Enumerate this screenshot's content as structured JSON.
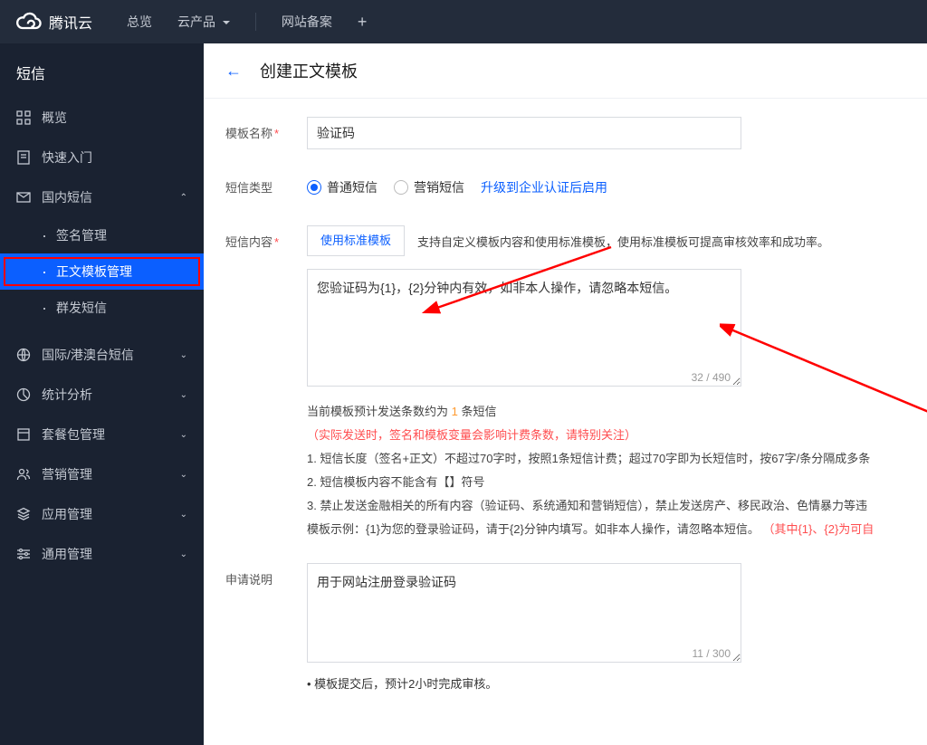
{
  "topNav": {
    "brand": "腾讯云",
    "links": [
      "总览",
      "云产品"
    ],
    "extra": [
      "网站备案"
    ]
  },
  "sidebar": {
    "title": "短信",
    "items": [
      {
        "name": "overview",
        "label": "概览",
        "icon": "grid"
      },
      {
        "name": "quickstart",
        "label": "快速入门",
        "icon": "doc"
      },
      {
        "name": "domestic-sms",
        "label": "国内短信",
        "icon": "mail",
        "expanded": true,
        "children": [
          {
            "name": "signature-mgmt",
            "label": "签名管理"
          },
          {
            "name": "template-mgmt",
            "label": "正文模板管理",
            "active": true,
            "highlighted": true
          },
          {
            "name": "mass-send",
            "label": "群发短信"
          }
        ]
      },
      {
        "name": "intl-sms",
        "label": "国际/港澳台短信",
        "icon": "globe",
        "chev": true
      },
      {
        "name": "statistics",
        "label": "统计分析",
        "icon": "chart",
        "chev": true
      },
      {
        "name": "package-mgmt",
        "label": "套餐包管理",
        "icon": "package",
        "chev": true
      },
      {
        "name": "marketing-mgmt",
        "label": "营销管理",
        "icon": "people",
        "chev": true
      },
      {
        "name": "app-mgmt",
        "label": "应用管理",
        "icon": "layers",
        "chev": true
      },
      {
        "name": "general-mgmt",
        "label": "通用管理",
        "icon": "sliders",
        "chev": true
      }
    ]
  },
  "page": {
    "title": "创建正文模板"
  },
  "form": {
    "nameLabel": "模板名称",
    "nameValue": "验证码",
    "typeLabel": "短信类型",
    "typeOptions": {
      "normal": "普通短信",
      "marketing": "营销短信"
    },
    "typeUpgrade": "升级到企业认证后启用",
    "contentLabel": "短信内容",
    "useStdBtn": "使用标准模板",
    "useStdHint": "支持自定义模板内容和使用标准模板，使用标准模板可提高审核效率和成功率。",
    "contentValue": "您验证码为{1}，{2}分钟内有效，如非本人操作，请忽略本短信。",
    "contentCount": "32 / 490",
    "descLabel": "申请说明",
    "descValue": "用于网站注册登录验证码",
    "descCount": "11 / 300"
  },
  "rules": {
    "predictPrefix": "当前模板预计发送条数约为 ",
    "predictCount": "1",
    "predictSuffix": " 条短信",
    "warn": "（实际发送时，签名和模板变量会影响计费条数，请特别关注）",
    "r1": "1. 短信长度（签名+正文）不超过70字时，按照1条短信计费；超过70字即为长短信时，按67字/条分隔成多条",
    "r2": "2. 短信模板内容不能含有【】符号",
    "r3": "3. 禁止发送金融相关的所有内容（验证码、系统通知和营销短信），禁止发送房产、移民政治、色情暴力等违",
    "examplePrefix": "模板示例：{1}为您的登录验证码，请于{2}分钟内填写。如非本人操作，请忽略本短信。",
    "exampleRed": "（其中{1}、{2}为可自",
    "footnote": "• 模板提交后，预计2小时完成审核。"
  }
}
